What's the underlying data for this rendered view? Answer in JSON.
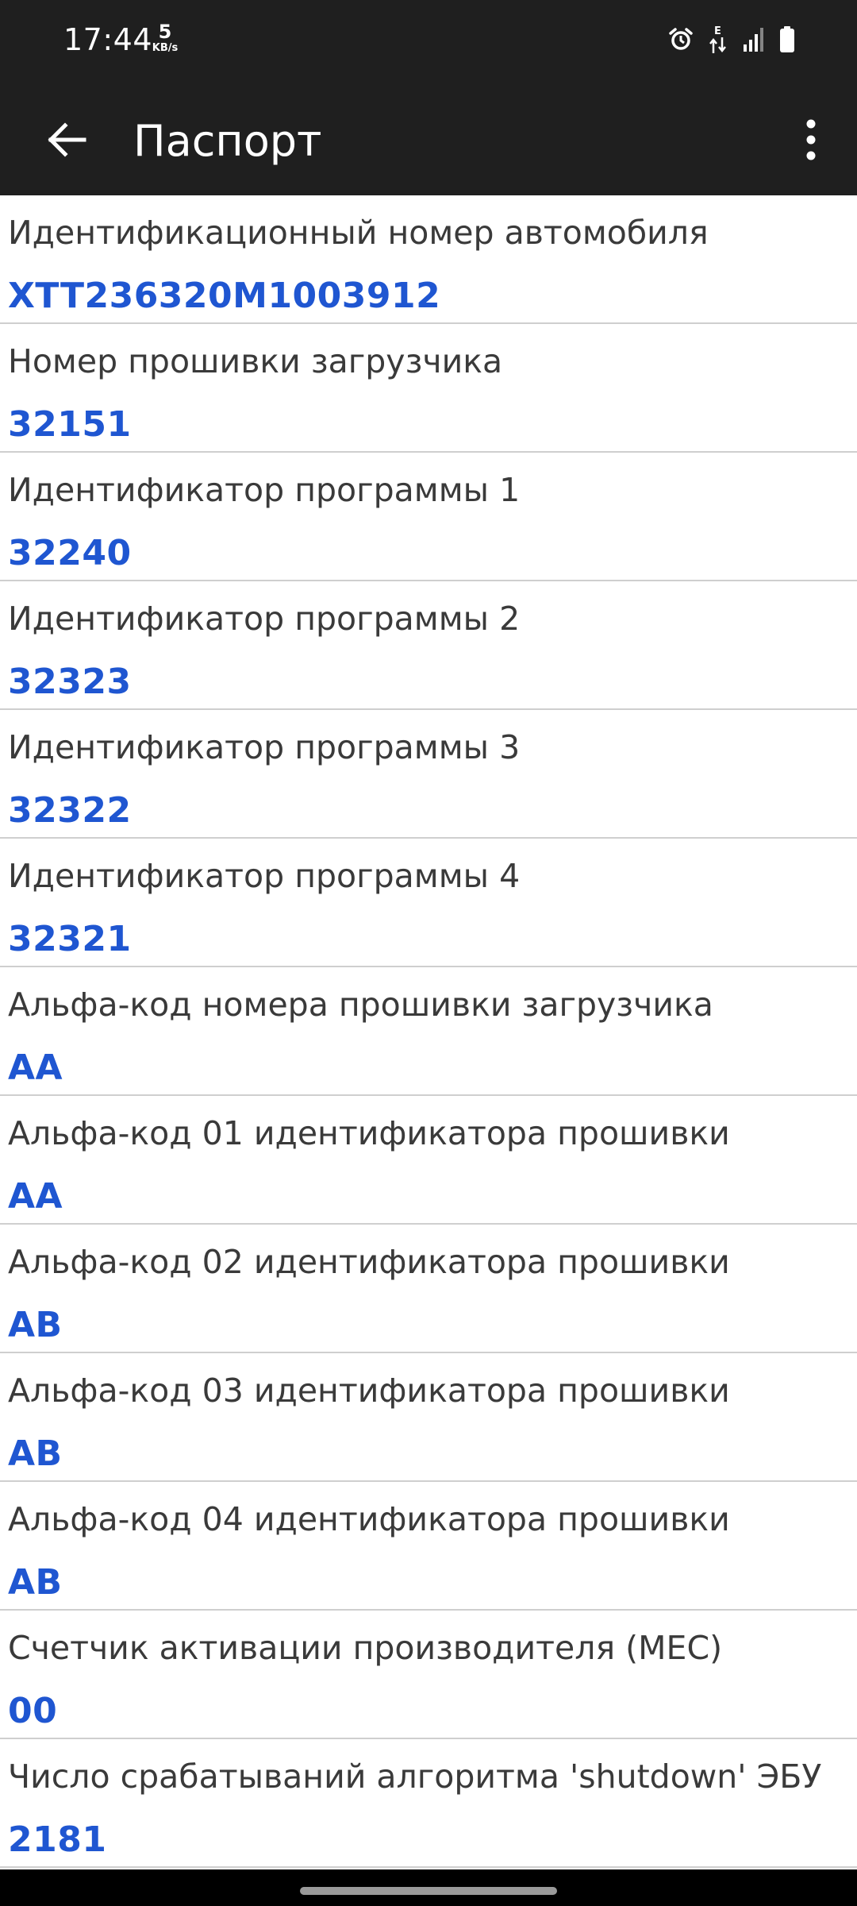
{
  "status_bar": {
    "time": "17:44",
    "speed_value": "5",
    "speed_unit": "KB/s",
    "icons": [
      "alarm-icon",
      "data-e-icon",
      "signal-icon",
      "battery-icon"
    ],
    "network_letter": "E"
  },
  "app_bar": {
    "title": "Паспорт",
    "back_icon": "arrow-left-icon",
    "menu_icon": "more-vert-icon"
  },
  "colors": {
    "bar_background": "#1f1f1f",
    "value_text": "#1f56d1",
    "label_text": "#3a3a3a",
    "divider": "#cfcfcf"
  },
  "items": [
    {
      "label": "Идентификационный номер автомобиля",
      "value": "XTT236320M1003912"
    },
    {
      "label": "Номер прошивки загрузчика",
      "value": "32151"
    },
    {
      "label": "Идентификатор программы 1",
      "value": "32240"
    },
    {
      "label": "Идентификатор программы 2",
      "value": "32323"
    },
    {
      "label": "Идентификатор программы 3",
      "value": "32322"
    },
    {
      "label": "Идентификатор программы 4",
      "value": "32321"
    },
    {
      "label": "Альфа-код номера прошивки загрузчика",
      "value": "AA"
    },
    {
      "label": "Альфа-код 01 идентификатора прошивки",
      "value": "AA"
    },
    {
      "label": "Альфа-код 02 идентификатора прошивки",
      "value": "AB"
    },
    {
      "label": "Альфа-код 03 идентификатора прошивки",
      "value": "AB"
    },
    {
      "label": "Альфа-код 04 идентификатора прошивки",
      "value": "AB"
    },
    {
      "label": "Счетчик активации производителя (MEC)",
      "value": "00"
    },
    {
      "label": "Число срабатываний алгоритма 'shutdown' ЭБУ",
      "value": "2181"
    }
  ]
}
